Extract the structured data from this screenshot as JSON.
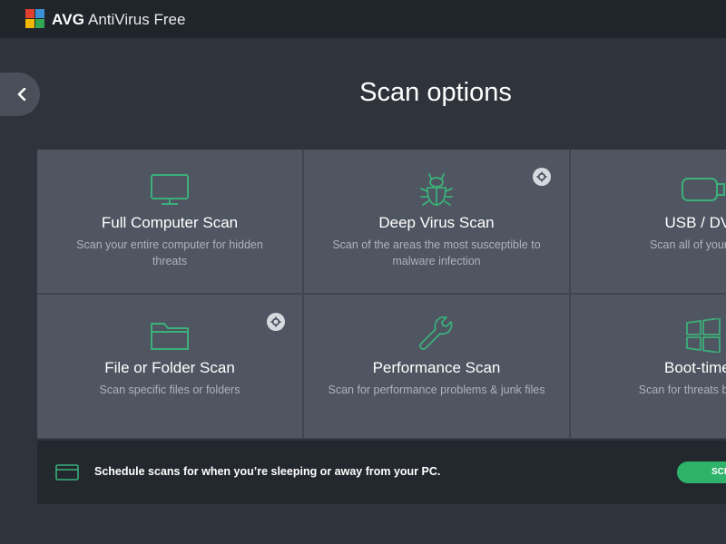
{
  "window": {
    "brand": "AVG",
    "app_name": "AntiVirus Free"
  },
  "page": {
    "title": "Scan options"
  },
  "tiles": [
    {
      "title": "Full Computer Scan",
      "desc_line1": "Scan your entire computer for hidden",
      "desc_line2": "threats",
      "icon": "monitor-icon",
      "has_settings": false
    },
    {
      "title": "Deep Virus Scan",
      "desc_line1": "Scan of the areas the most susceptible to",
      "desc_line2": "malware infection",
      "icon": "bug-icon",
      "has_settings": true
    },
    {
      "title": "USB / DVD",
      "desc_line1": "Scan all of your remo",
      "desc_line2": "",
      "icon": "usb-drive-icon",
      "has_settings": false
    },
    {
      "title": "File or Folder Scan",
      "desc_line1": "Scan specific files or folders",
      "desc_line2": "",
      "icon": "folder-icon",
      "has_settings": true
    },
    {
      "title": "Performance Scan",
      "desc_line1": "Scan for performance problems & junk files",
      "desc_line2": "",
      "icon": "wrench-icon",
      "has_settings": false
    },
    {
      "title": "Boot-time s",
      "desc_line1": "Scan for threats before W",
      "desc_line2": "",
      "icon": "windows-icon",
      "has_settings": false
    }
  ],
  "bottom_bar": {
    "text": "Schedule scans for when you’re sleeping or away from your PC.",
    "button_label": "SCH",
    "icon": "calendar-icon"
  },
  "colors": {
    "accent_green": "#2fb36a",
    "icon_green": "#3bb07a",
    "titlebar_bg": "#20242b",
    "tile_bg": "#4f5561"
  }
}
